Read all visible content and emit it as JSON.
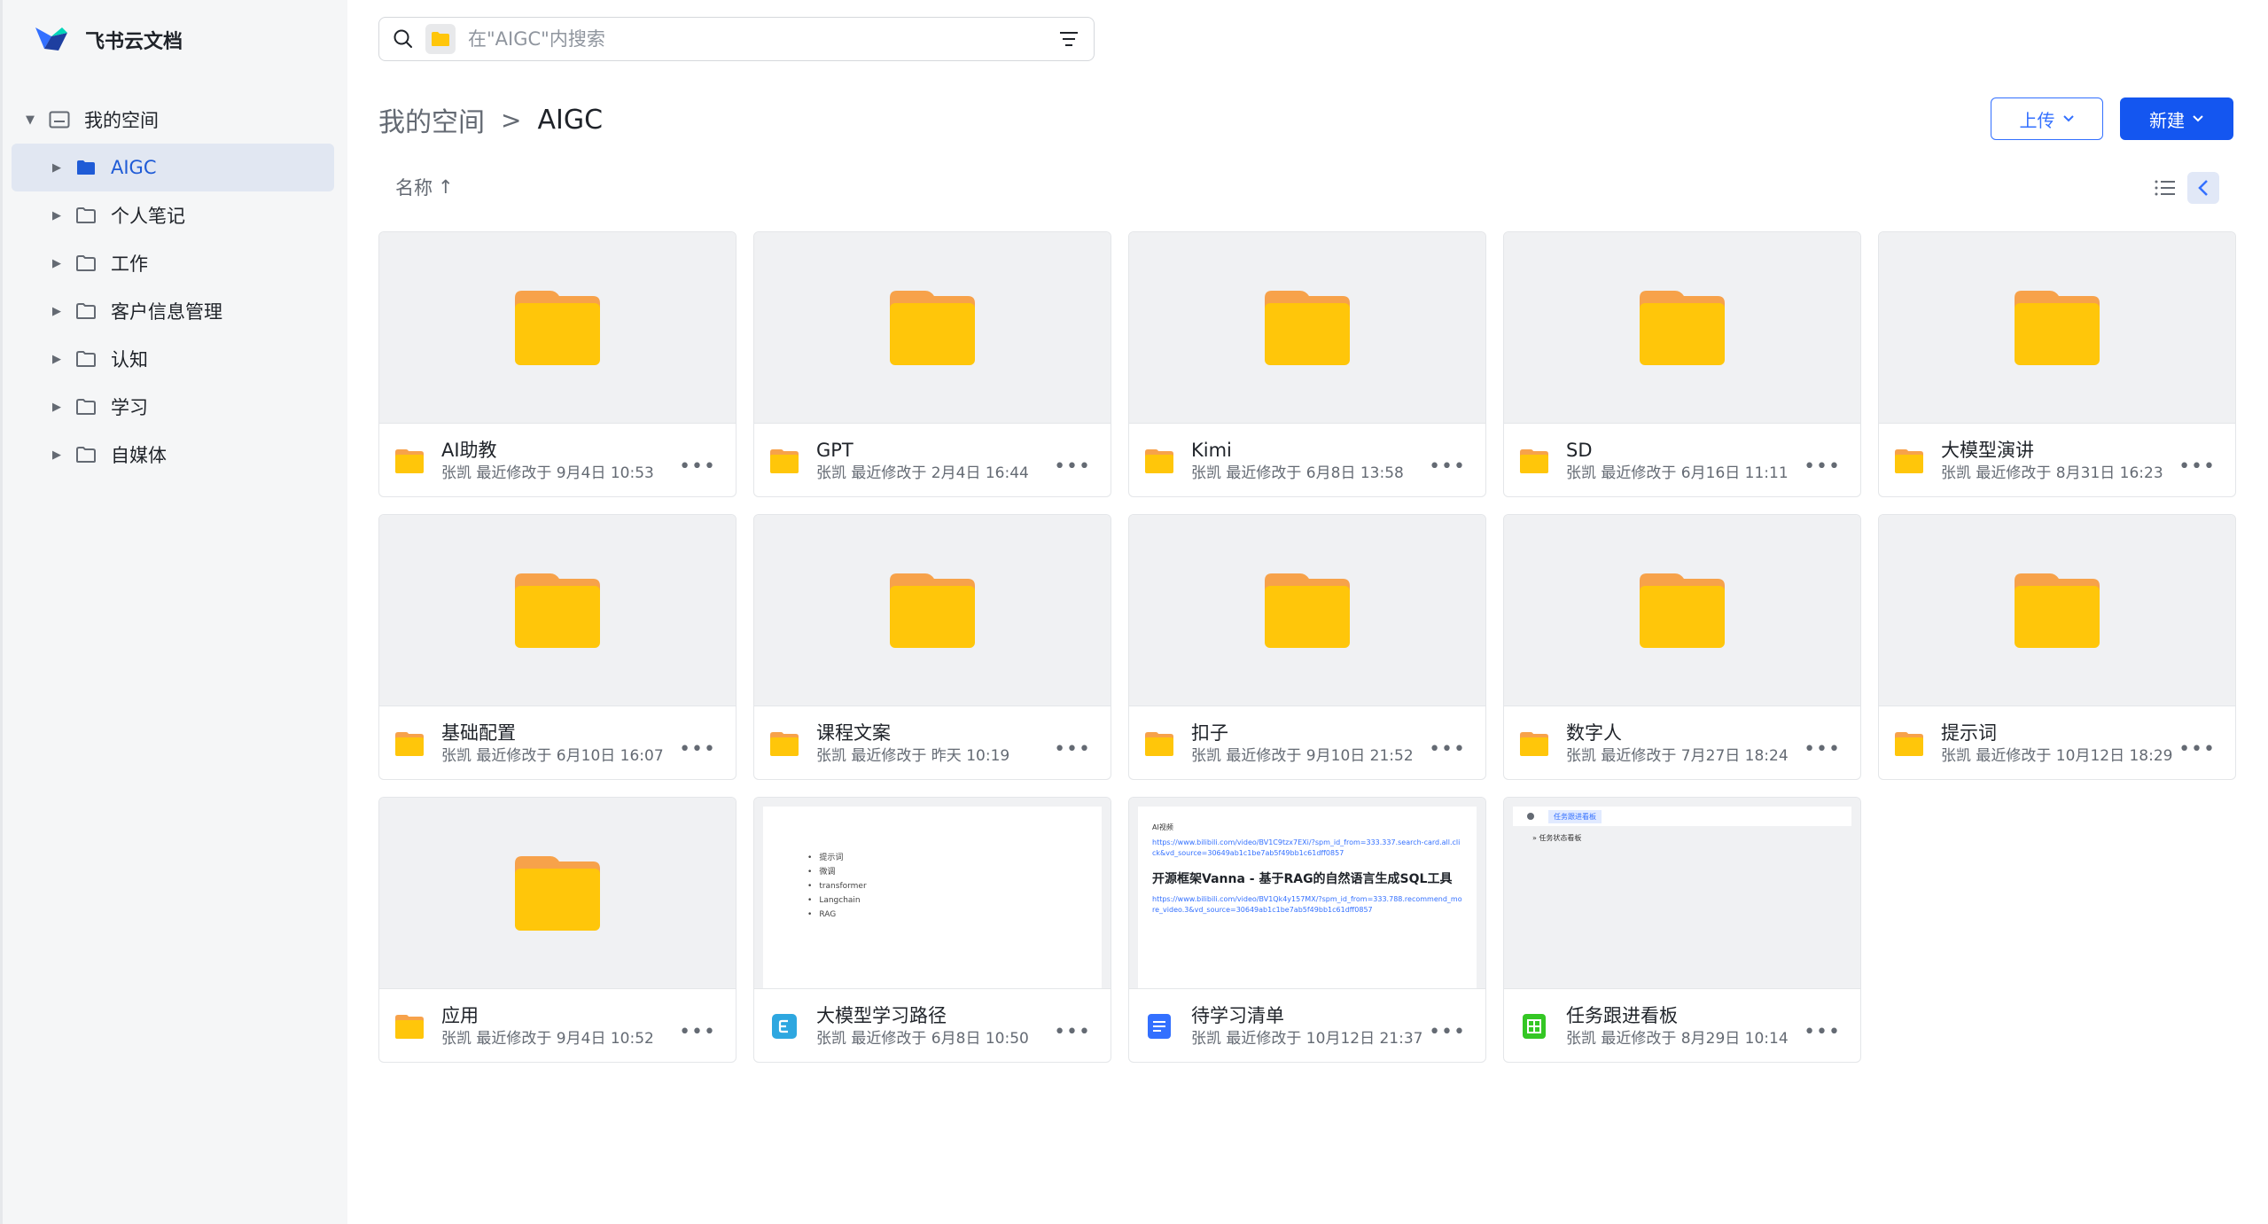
{
  "app": {
    "name": "飞书云文档"
  },
  "sidebar": {
    "root_label": "我的空间",
    "items": [
      {
        "label": "AIGC",
        "active": true
      },
      {
        "label": "个人笔记"
      },
      {
        "label": "工作"
      },
      {
        "label": "客户信息管理"
      },
      {
        "label": "认知"
      },
      {
        "label": "学习"
      },
      {
        "label": "自媒体"
      }
    ]
  },
  "search": {
    "placeholder": "在\"AIGC\"内搜索"
  },
  "breadcrumb": {
    "root": "我的空间",
    "separator": ">",
    "current": "AIGC"
  },
  "toolbar": {
    "upload_label": "上传",
    "new_label": "新建",
    "sort_label": "名称",
    "sort_arrow": "↑"
  },
  "items": [
    {
      "name": "AI助教",
      "sub": "张凯 最近修改于 9月4日 10:53",
      "type": "folder"
    },
    {
      "name": "GPT",
      "sub": "张凯 最近修改于 2月4日 16:44",
      "type": "folder"
    },
    {
      "name": "Kimi",
      "sub": "张凯 最近修改于 6月8日 13:58",
      "type": "folder"
    },
    {
      "name": "SD",
      "sub": "张凯 最近修改于 6月16日 11:11",
      "type": "folder"
    },
    {
      "name": "大模型演讲",
      "sub": "张凯 最近修改于 8月31日 16:23",
      "type": "folder"
    },
    {
      "name": "基础配置",
      "sub": "张凯 最近修改于 6月10日 16:07",
      "type": "folder"
    },
    {
      "name": "课程文案",
      "sub": "张凯 最近修改于 昨天 10:19",
      "type": "folder"
    },
    {
      "name": "扣子",
      "sub": "张凯 最近修改于 9月10日 21:52",
      "type": "folder"
    },
    {
      "name": "数字人",
      "sub": "张凯 最近修改于 7月27日 18:24",
      "type": "folder"
    },
    {
      "name": "提示词",
      "sub": "张凯 最近修改于 10月12日 18:29",
      "type": "folder"
    },
    {
      "name": "应用",
      "sub": "张凯 最近修改于 9月4日 10:52",
      "type": "folder"
    },
    {
      "name": "大模型学习路径",
      "sub": "张凯 最近修改于 6月8日 10:50",
      "type": "mindnote"
    },
    {
      "name": "待学习清单",
      "sub": "张凯 最近修改于 10月12日 21:37",
      "type": "doc"
    },
    {
      "name": "任务跟进看板",
      "sub": "张凯 最近修改于 8月29日 10:14",
      "type": "sheet"
    }
  ],
  "previews": {
    "mindnote": [
      "提示词",
      "微调",
      "transformer",
      "Langchain",
      "RAG"
    ],
    "doc": {
      "heading": "AI视频",
      "link1": "https://www.bilibili.com/video/BV1C9tzx7EXi/?spm_id_from=333.337.search-card.all.click&vd_source=30649ab1c1be7ab5f49bb1c61dff0857",
      "title": "开源框架Vanna - 基于RAG的自然语言生成SQL工具",
      "link2": "https://www.bilibili.com/video/BV1Qk4y157MX/?spm_id_from=333.788.recommend_more_video.3&vd_source=30649ab1c1be7ab5f49bb1c61dff0857"
    },
    "sheet": {
      "tab": "任务跟进看板",
      "row": "任务状态看板"
    }
  },
  "colors": {
    "accent": "#3370ff",
    "folder": "#ffc60a",
    "folder_tab": "#f7a24a"
  }
}
